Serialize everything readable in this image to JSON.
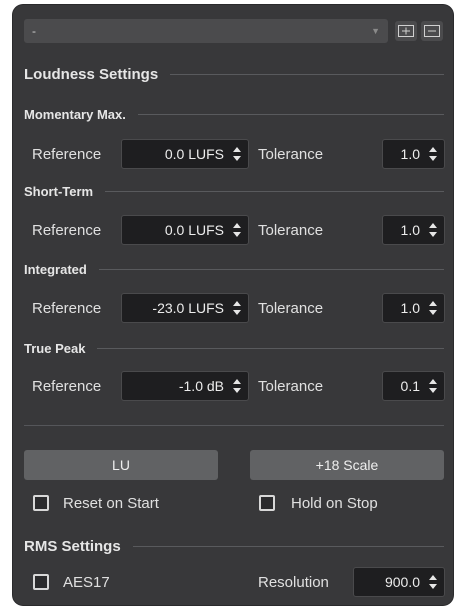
{
  "preset": {
    "value": "-"
  },
  "loudness": {
    "title": "Loudness Settings"
  },
  "sections": [
    {
      "title": "Momentary Max.",
      "ref_label": "Reference",
      "ref_value": "0.0 LUFS",
      "tol_label": "Tolerance",
      "tol_value": "1.0"
    },
    {
      "title": "Short-Term",
      "ref_label": "Reference",
      "ref_value": "0.0 LUFS",
      "tol_label": "Tolerance",
      "tol_value": "1.0"
    },
    {
      "title": "Integrated",
      "ref_label": "Reference",
      "ref_value": "-23.0 LUFS",
      "tol_label": "Tolerance",
      "tol_value": "1.0"
    },
    {
      "title": "True Peak",
      "ref_label": "Reference",
      "ref_value": "-1.0 dB",
      "tol_label": "Tolerance",
      "tol_value": "0.1"
    }
  ],
  "buttons": {
    "lu": "LU",
    "scale": "+18 Scale"
  },
  "checks": {
    "reset_on_start": "Reset on Start",
    "hold_on_stop": "Hold on Stop"
  },
  "rms": {
    "title": "RMS Settings",
    "aes17": "AES17",
    "resolution_label": "Resolution",
    "resolution_value": "900.0"
  },
  "icons": {
    "add": "add-preset-icon",
    "remove": "remove-preset-icon",
    "spin": "spinner-icon"
  }
}
